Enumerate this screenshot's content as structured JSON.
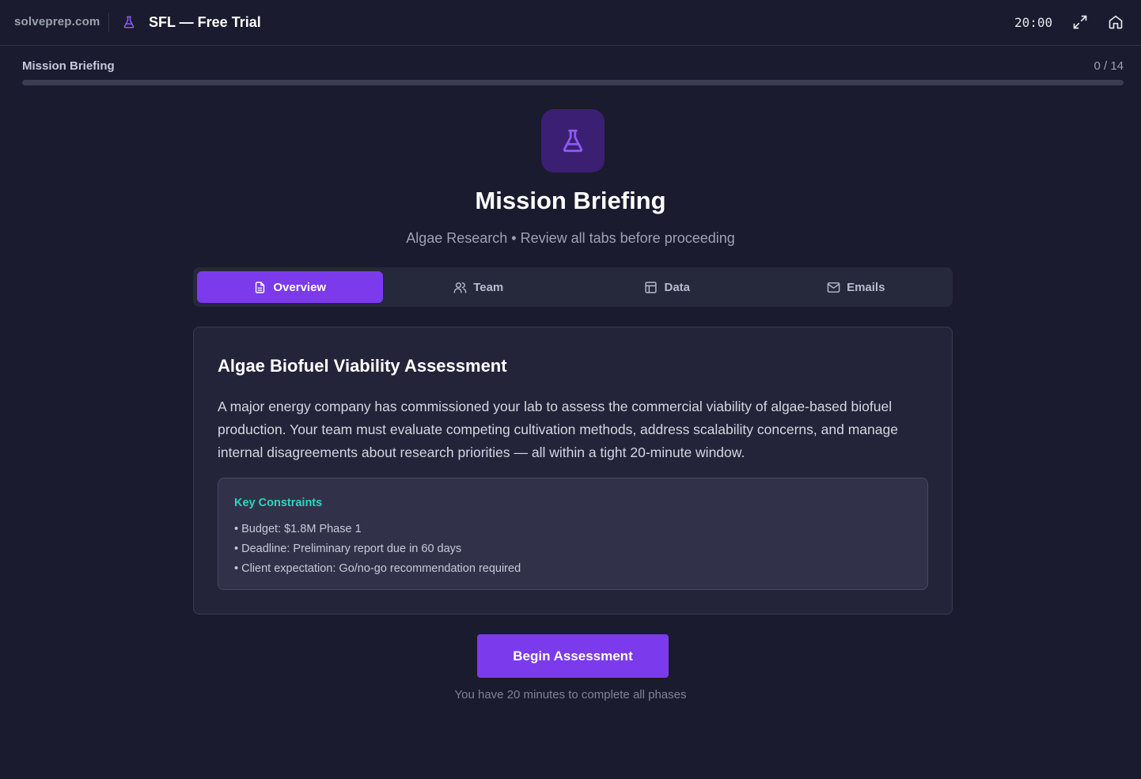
{
  "header": {
    "site": "solveprep.com",
    "app_title": "SFL — Free Trial",
    "timer": "20:00"
  },
  "progress": {
    "label": "Mission Briefing",
    "count": "0 / 14",
    "fraction": 0
  },
  "hero": {
    "title": "Mission Briefing",
    "subtitle": "Algae Research • Review all tabs before proceeding"
  },
  "tabs": [
    {
      "label": "Overview",
      "icon": "document-icon",
      "active": true
    },
    {
      "label": "Team",
      "icon": "users-icon",
      "active": false
    },
    {
      "label": "Data",
      "icon": "table-icon",
      "active": false
    },
    {
      "label": "Emails",
      "icon": "mail-icon",
      "active": false
    }
  ],
  "overview": {
    "title": "Algae Biofuel Viability Assessment",
    "body": "A major energy company has commissioned your lab to assess the commercial viability of algae-based biofuel production. Your team must evaluate competing cultivation methods, address scalability concerns, and manage internal disagreements about research priorities — all within a tight 20-minute window.",
    "constraints": {
      "title": "Key Constraints",
      "items": [
        "• Budget: $1.8M Phase 1",
        "• Deadline: Preliminary report due in 60 days",
        "• Client expectation: Go/no-go recommendation required"
      ]
    }
  },
  "cta": {
    "label": "Begin Assessment",
    "note": "You have 20 minutes to complete all phases"
  },
  "colors": {
    "accent": "#7c3aed",
    "teal": "#2dd4bf",
    "background": "#1a1b2e"
  }
}
